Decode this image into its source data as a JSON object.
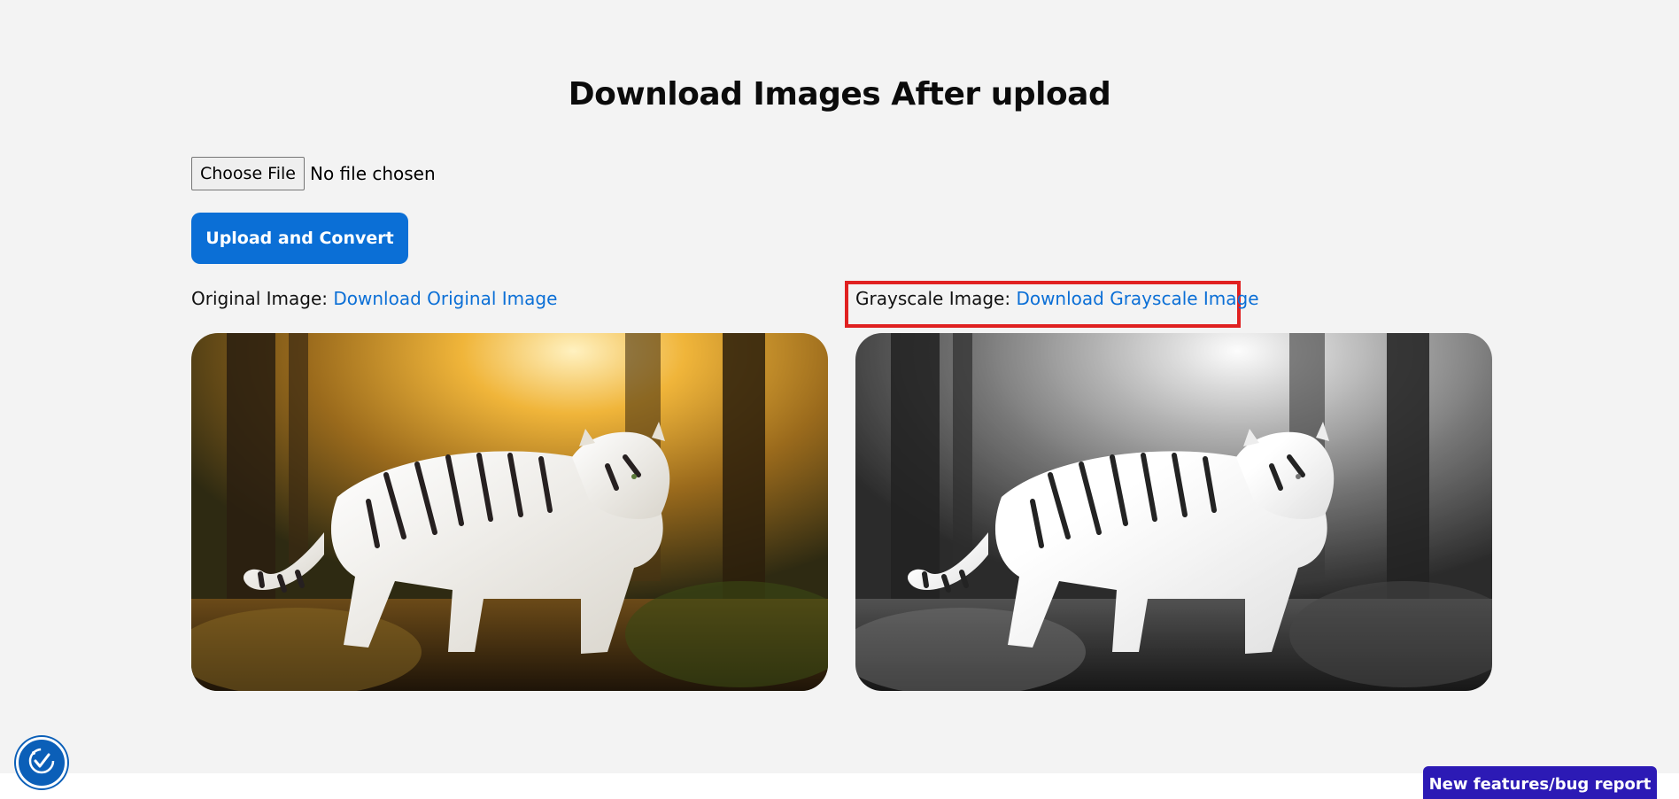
{
  "page": {
    "title": "Download Images After upload"
  },
  "file_input": {
    "button_label": "Choose File",
    "status": "No file chosen"
  },
  "upload_button": {
    "label": "Upload and Convert"
  },
  "original": {
    "label": "Original Image:",
    "link_text": "Download Original Image"
  },
  "grayscale": {
    "label": "Grayscale Image:",
    "link_text": "Download Grayscale Image"
  },
  "feedback_button": {
    "label": "New features/bug report"
  },
  "icons": {
    "accessibility": "accessibility-icon"
  },
  "colors": {
    "primary": "#0b6fd6",
    "highlight": "#e02020",
    "feedback": "#2c1ab5",
    "background": "#f3f3f3"
  }
}
